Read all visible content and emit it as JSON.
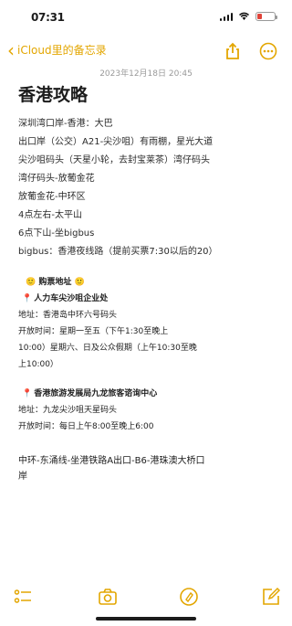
{
  "status": {
    "time": "07:31"
  },
  "nav": {
    "back_label": "iCloud里的备忘录"
  },
  "note": {
    "date": "2023年12月18日 20:45",
    "title": "香港攻略",
    "lines": [
      "深圳湾口岸-香港：大巴",
      "出口岸（公交）A21-尖沙咀）有雨棚，星光大道",
      "尖沙咀码头（天星小轮，去封宝莱茶）湾仔码头",
      "湾仔码头-放葡金花",
      "放葡金花-中环区",
      "4点左右-太平山",
      "6点下山-坐bigbus",
      "bigbus：香港夜线路（提前买票7:30以后的20）"
    ],
    "block1": {
      "heading": "🙂 购票地址 🙂",
      "name": "人力车尖沙咀企业处",
      "address": "地址：香港岛中环六号码头",
      "hours1": "开放时间：星期一至五（下午1:30至晚上",
      "hours2": "10:00）星期六、日及公众假期（上午10:30至晚",
      "hours3": "上10:00）"
    },
    "block2": {
      "name": "香港旅游发展局九龙旅客谘询中心",
      "address": "地址：九龙尖沙咀天星码头",
      "hours": "开放时间：每日上午8:00至晚上6:00"
    },
    "footer1": "中环-东涌线-坐港铁路A出口-B6-港珠澳大桥口",
    "footer2": "岸"
  },
  "icons": {
    "back": "chevron-left-icon",
    "share": "share-icon",
    "more": "more-circle-icon",
    "checklist": "checklist-icon",
    "camera": "camera-icon",
    "markup": "markup-icon",
    "compose": "compose-icon"
  },
  "colors": {
    "accent": "#e3a600",
    "pin": "#d33333"
  }
}
